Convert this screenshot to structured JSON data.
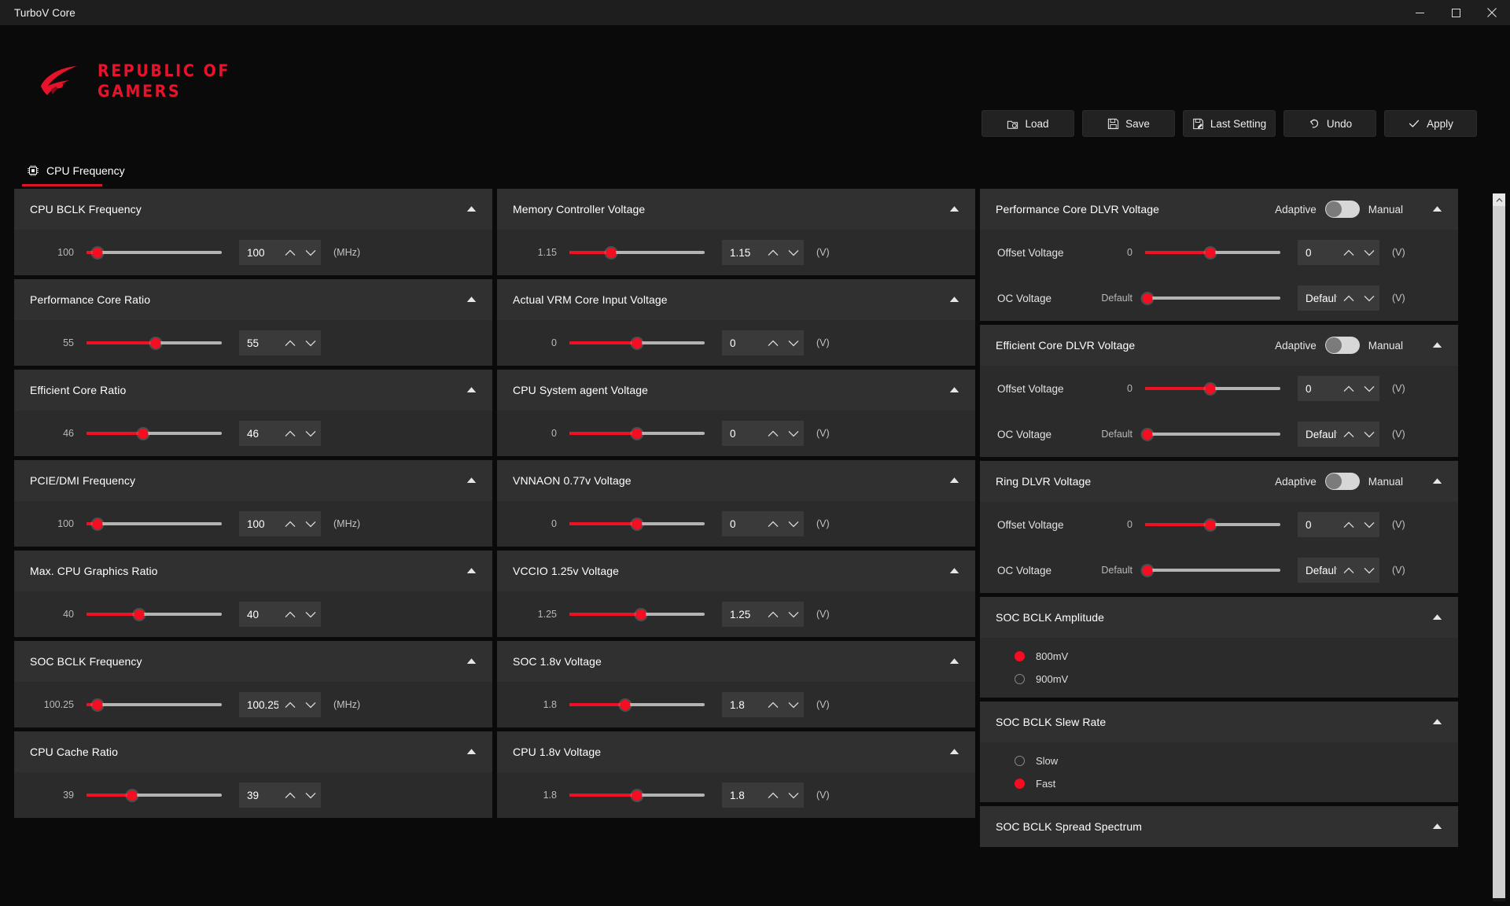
{
  "window": {
    "title": "TurboV Core",
    "controls": [
      {
        "name": "minimize",
        "glyph": "minimize-icon"
      },
      {
        "name": "maximize",
        "glyph": "maximize-icon"
      },
      {
        "name": "close",
        "glyph": "close-icon"
      }
    ]
  },
  "brand": {
    "line1": "REPUBLIC OF",
    "line2": "GAMERS",
    "color": "#e8132b"
  },
  "toolbar": [
    {
      "label": "Load",
      "icon": "load-icon"
    },
    {
      "label": "Save",
      "icon": "save-icon"
    },
    {
      "label": "Last Setting",
      "icon": "last-setting-icon"
    },
    {
      "label": "Undo",
      "icon": "undo-icon"
    },
    {
      "label": "Apply",
      "icon": "check-icon"
    }
  ],
  "tabs": [
    {
      "label": "CPU Frequency",
      "icon": "cpu-icon",
      "active": true
    }
  ],
  "accent": "#f50d21",
  "toggle_labels": {
    "left": "Adaptive",
    "right": "Manual"
  },
  "columns": [
    {
      "id": "left",
      "cards": [
        {
          "title": "CPU BCLK Frequency",
          "rows": [
            {
              "label": "",
              "min": "100",
              "value": "100",
              "unit": "(MHz)",
              "fill": 8,
              "knob": 8
            }
          ]
        },
        {
          "title": "Performance Core Ratio",
          "rows": [
            {
              "label": "",
              "min": "55",
              "value": "55",
              "unit": "",
              "fill": 51,
              "knob": 51
            }
          ]
        },
        {
          "title": "Efficient Core Ratio",
          "rows": [
            {
              "label": "",
              "min": "46",
              "value": "46",
              "unit": "",
              "fill": 42,
              "knob": 42
            }
          ]
        },
        {
          "title": "PCIE/DMI Frequency",
          "rows": [
            {
              "label": "",
              "min": "100",
              "value": "100",
              "unit": "(MHz)",
              "fill": 8,
              "knob": 8
            }
          ]
        },
        {
          "title": "Max. CPU Graphics Ratio",
          "rows": [
            {
              "label": "",
              "min": "40",
              "value": "40",
              "unit": "",
              "fill": 39,
              "knob": 39
            }
          ]
        },
        {
          "title": "SOC BCLK Frequency",
          "rows": [
            {
              "label": "",
              "min": "100.25",
              "value": "100.25",
              "unit": "(MHz)",
              "fill": 8,
              "knob": 8
            }
          ]
        },
        {
          "title": "CPU Cache Ratio",
          "rows": [
            {
              "label": "",
              "min": "39",
              "value": "39",
              "unit": "",
              "fill": 34,
              "knob": 34
            }
          ]
        }
      ]
    },
    {
      "id": "middle",
      "cards": [
        {
          "title": "Memory Controller Voltage",
          "rows": [
            {
              "label": "",
              "min": "1.15",
              "value": "1.15",
              "unit": "(V)",
              "fill": 31,
              "knob": 31
            }
          ]
        },
        {
          "title": "Actual VRM Core Input Voltage",
          "rows": [
            {
              "label": "",
              "min": "0",
              "value": "0",
              "unit": "(V)",
              "fill": 50,
              "knob": 50
            }
          ]
        },
        {
          "title": "CPU System agent Voltage",
          "rows": [
            {
              "label": "",
              "min": "0",
              "value": "0",
              "unit": "(V)",
              "fill": 50,
              "knob": 50
            }
          ]
        },
        {
          "title": "VNNAON 0.77v Voltage",
          "rows": [
            {
              "label": "",
              "min": "0",
              "value": "0",
              "unit": "(V)",
              "fill": 50,
              "knob": 50
            }
          ]
        },
        {
          "title": "VCCIO 1.25v Voltage",
          "rows": [
            {
              "label": "",
              "min": "1.25",
              "value": "1.25",
              "unit": "(V)",
              "fill": 53,
              "knob": 53
            }
          ]
        },
        {
          "title": "SOC 1.8v Voltage",
          "rows": [
            {
              "label": "",
              "min": "1.8",
              "value": "1.8",
              "unit": "(V)",
              "fill": 41,
              "knob": 41
            }
          ]
        },
        {
          "title": "CPU 1.8v Voltage",
          "rows": [
            {
              "label": "",
              "min": "1.8",
              "value": "1.8",
              "unit": "(V)",
              "fill": 50,
              "knob": 50
            }
          ]
        }
      ]
    },
    {
      "id": "right",
      "cards": [
        {
          "title": "Performance Core DLVR Voltage",
          "toggle": true,
          "rows": [
            {
              "label": "Offset Voltage",
              "min": "0",
              "value": "0",
              "unit": "(V)",
              "fill": 48,
              "knob": 48
            },
            {
              "label": "OC Voltage",
              "min": "Default",
              "value": "Default",
              "unit": "(V)",
              "fill": 0,
              "knob": 2
            }
          ]
        },
        {
          "title": "Efficient Core DLVR Voltage",
          "toggle": true,
          "rows": [
            {
              "label": "Offset Voltage",
              "min": "0",
              "value": "0",
              "unit": "(V)",
              "fill": 48,
              "knob": 48
            },
            {
              "label": "OC Voltage",
              "min": "Default",
              "value": "Default",
              "unit": "(V)",
              "fill": 0,
              "knob": 2
            }
          ]
        },
        {
          "title": "Ring DLVR Voltage",
          "toggle": true,
          "rows": [
            {
              "label": "Offset Voltage",
              "min": "0",
              "value": "0",
              "unit": "(V)",
              "fill": 48,
              "knob": 48
            },
            {
              "label": "OC Voltage",
              "min": "Default",
              "value": "Default",
              "unit": "(V)",
              "fill": 0,
              "knob": 2
            }
          ]
        },
        {
          "title": "SOC BCLK Amplitude",
          "radios": [
            {
              "label": "800mV",
              "selected": true
            },
            {
              "label": "900mV",
              "selected": false
            }
          ]
        },
        {
          "title": "SOC BCLK Slew Rate",
          "radios": [
            {
              "label": "Slow",
              "selected": false
            },
            {
              "label": "Fast",
              "selected": true
            }
          ]
        },
        {
          "title": "SOC BCLK Spread Spectrum"
        }
      ]
    }
  ]
}
